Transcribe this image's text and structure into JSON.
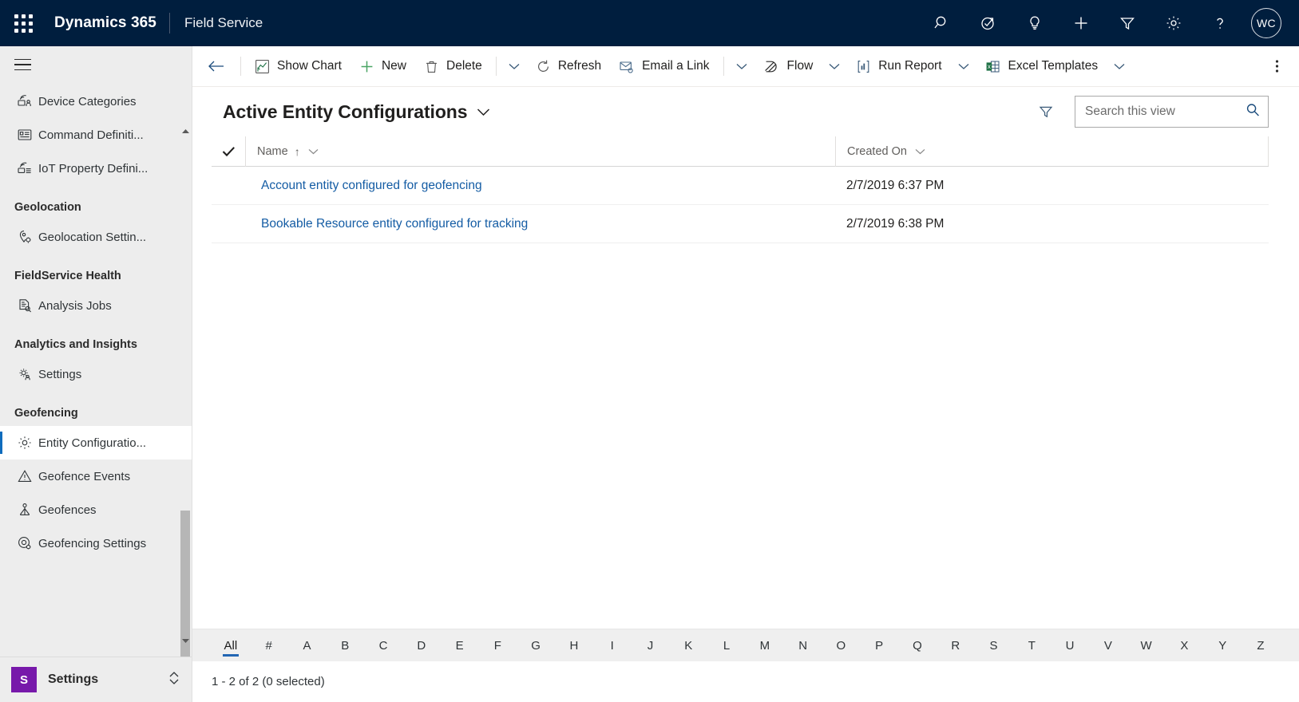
{
  "topnav": {
    "waffle_label": "app-launcher",
    "brand": "Dynamics 365",
    "app_name": "Field Service",
    "icons": [
      {
        "name": "search-icon",
        "label": "Search"
      },
      {
        "name": "assistant-icon",
        "label": "Assistant"
      },
      {
        "name": "lightbulb-icon",
        "label": "Insights"
      },
      {
        "name": "plus-icon",
        "label": "Quick create"
      },
      {
        "name": "filter-icon",
        "label": "Filter"
      },
      {
        "name": "gear-icon",
        "label": "Settings"
      },
      {
        "name": "help-icon",
        "label": "Help"
      }
    ],
    "avatar_initials": "WC"
  },
  "sidebar": {
    "hamburger_label": "Expand / collapse site map",
    "items": [
      {
        "label": "Device Categories",
        "icon": "device-category-icon",
        "type": "item",
        "selected": false
      },
      {
        "label": "Command Definiti...",
        "icon": "command-definition-icon",
        "type": "item",
        "selected": false
      },
      {
        "label": "IoT Property Defini...",
        "icon": "iot-property-icon",
        "type": "item",
        "selected": false
      },
      {
        "label": "Geolocation",
        "type": "group"
      },
      {
        "label": "Geolocation Settin...",
        "icon": "location-settings-icon",
        "type": "item",
        "selected": false
      },
      {
        "label": "FieldService Health",
        "type": "group"
      },
      {
        "label": "Analysis Jobs",
        "icon": "analysis-jobs-icon",
        "type": "item",
        "selected": false
      },
      {
        "label": "Analytics and Insights",
        "type": "group"
      },
      {
        "label": "Settings",
        "icon": "settings-people-icon",
        "type": "item",
        "selected": false
      },
      {
        "label": "Geofencing",
        "type": "group"
      },
      {
        "label": "Entity Configuratio...",
        "icon": "gear-icon",
        "type": "item",
        "selected": true
      },
      {
        "label": "Geofence Events",
        "icon": "warning-triangle-icon",
        "type": "item",
        "selected": false
      },
      {
        "label": "Geofences",
        "icon": "geofence-icon",
        "type": "item",
        "selected": false
      },
      {
        "label": "Geofencing Settings",
        "icon": "geofence-settings-icon",
        "type": "item",
        "selected": false
      }
    ],
    "footer": {
      "badge": "S",
      "area_name": "Settings",
      "switcher_icon": "up-down-chevron-icon"
    },
    "accent_selected": "#0f6cbd",
    "badge_color": "#7719aa"
  },
  "commandbar": {
    "back_label": "Back",
    "commands": [
      {
        "label": "Show Chart",
        "icon": "show-chart-icon",
        "caret": false
      },
      {
        "label": "New",
        "icon": "plus-icon",
        "caret": false
      },
      {
        "label": "Delete",
        "icon": "trash-icon",
        "caret": true
      },
      {
        "label": "Refresh",
        "icon": "refresh-icon",
        "caret": false
      },
      {
        "label": "Email a Link",
        "icon": "email-link-icon",
        "caret": true
      },
      {
        "label": "Flow",
        "icon": "flow-icon",
        "caret": true
      },
      {
        "label": "Run Report",
        "icon": "run-report-icon",
        "caret": true
      },
      {
        "label": "Excel Templates",
        "icon": "excel-icon",
        "caret": true
      }
    ],
    "overflow_label": "More commands"
  },
  "view": {
    "title": "Active Entity Configurations",
    "title_caret_icon": "chevron-down-icon",
    "filter_icon": "filter-icon",
    "search": {
      "placeholder": "Search this view",
      "value": "",
      "icon": "search-icon"
    }
  },
  "grid": {
    "select_all_icon": "checkmark-icon",
    "columns": [
      {
        "label": "Name",
        "sort": "↑",
        "caret_icon": "chevron-down-icon"
      },
      {
        "label": "Created On",
        "sort": "",
        "caret_icon": "chevron-down-icon"
      }
    ],
    "rows": [
      {
        "name": "Account entity configured for geofencing",
        "created_on": "2/7/2019 6:37 PM"
      },
      {
        "name": "Bookable Resource entity configured for tracking",
        "created_on": "2/7/2019 6:38 PM"
      }
    ],
    "link_color": "#145ca4"
  },
  "alphabar": {
    "active": "All",
    "items": [
      "All",
      "#",
      "A",
      "B",
      "C",
      "D",
      "E",
      "F",
      "G",
      "H",
      "I",
      "J",
      "K",
      "L",
      "M",
      "N",
      "O",
      "P",
      "Q",
      "R",
      "S",
      "T",
      "U",
      "V",
      "W",
      "X",
      "Y",
      "Z"
    ],
    "underline_color": "#2266b3"
  },
  "statusbar": {
    "text": "1 - 2 of 2 (0 selected)"
  }
}
